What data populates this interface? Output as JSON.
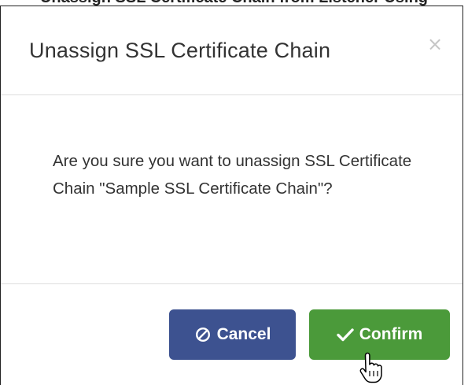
{
  "background_fragment": {
    "text": "Unassign SSL Certificate Chain from Listener Using"
  },
  "dialog": {
    "title": "Unassign SSL Certificate Chain",
    "close_symbol": "×",
    "message": "Are you sure you want to unassign SSL Certificate Chain \"Sample SSL Certificate Chain\"?",
    "cancel": {
      "label": "Cancel",
      "icon": "ban-icon",
      "color": "#3d5290"
    },
    "confirm": {
      "label": "Confirm",
      "icon": "check-icon",
      "color": "#4b9a3a"
    }
  },
  "cursor": {
    "icon": "hand-pointer-icon"
  }
}
